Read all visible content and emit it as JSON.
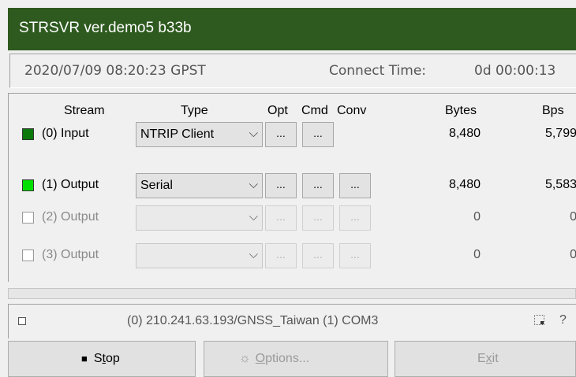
{
  "window": {
    "title": "STRSVR ver.demo5 b33b"
  },
  "info": {
    "datetime": "2020/07/09 08:20:23 GPST",
    "connect_label": "Connect Time:",
    "connect_value": "0d 00:00:13"
  },
  "headers": {
    "stream": "Stream",
    "type": "Type",
    "opt": "Opt",
    "cmd": "Cmd",
    "conv": "Conv",
    "bytes": "Bytes",
    "bps": "Bps"
  },
  "rows": [
    {
      "label": "(0) Input",
      "type": "NTRIP Client",
      "opt": "...",
      "cmd": "...",
      "bytes": "8,480",
      "bps": "5,799",
      "checked": true,
      "enabled": true
    },
    {
      "label": "(1) Output",
      "type": "Serial",
      "opt": "...",
      "cmd": "...",
      "conv": "...",
      "bytes": "8,480",
      "bps": "5,583",
      "checked": true,
      "enabled": true
    },
    {
      "label": "(2) Output",
      "type": "",
      "opt": "...",
      "cmd": "...",
      "conv": "...",
      "bytes": "0",
      "bps": "0",
      "checked": false,
      "enabled": false
    },
    {
      "label": "(3) Output",
      "type": "",
      "opt": "...",
      "cmd": "...",
      "conv": "...",
      "bytes": "0",
      "bps": "0",
      "checked": false,
      "enabled": false
    }
  ],
  "colors": {
    "titlebar": "#2e5a1f",
    "input_active": "#0b7a0b",
    "output_active": "#00e000"
  },
  "status": {
    "text": "(0) 210.241.63.193/GNSS_Taiwan (1) COM3",
    "help": "?"
  },
  "buttons": {
    "stop_icon": "■",
    "stop_pre": "S",
    "stop_u": "t",
    "stop_post": "op",
    "options_icon": "☼",
    "options_u": "O",
    "options_post": "ptions...",
    "exit_pre": "E",
    "exit_u": "x",
    "exit_post": "it"
  },
  "icons": {
    "combo_arrow": "chevron-down-icon",
    "stop": "stop-square-icon",
    "options": "gear-icon"
  }
}
